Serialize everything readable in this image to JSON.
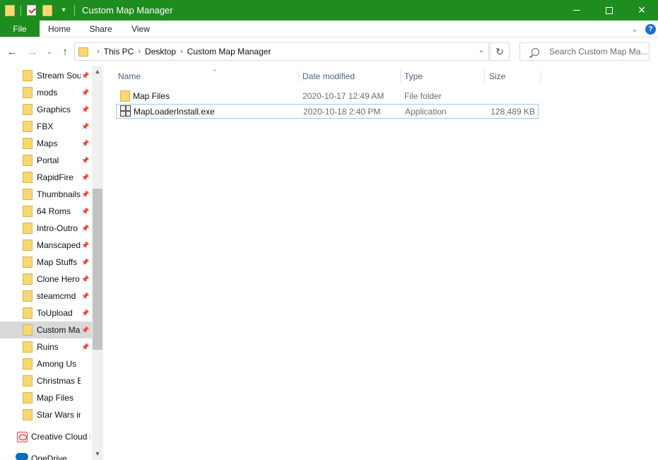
{
  "window": {
    "title": "Custom Map Manager",
    "accent_color": "#1e8c1e"
  },
  "ribbon": {
    "tabs": [
      "File",
      "Home",
      "Share",
      "View"
    ],
    "help": "?"
  },
  "address": {
    "crumbs": [
      "This PC",
      "Desktop",
      "Custom Map Manager"
    ]
  },
  "search": {
    "placeholder": "Search Custom Map Ma..."
  },
  "navpane": {
    "quick_access": [
      {
        "label": "Stream Sou",
        "pinned": true,
        "selected": false
      },
      {
        "label": "mods",
        "pinned": true,
        "selected": false
      },
      {
        "label": "Graphics",
        "pinned": true,
        "selected": false
      },
      {
        "label": "FBX",
        "pinned": true,
        "selected": false
      },
      {
        "label": "Maps",
        "pinned": true,
        "selected": false
      },
      {
        "label": "Portal",
        "pinned": true,
        "selected": false
      },
      {
        "label": "RapidFire",
        "pinned": true,
        "selected": false
      },
      {
        "label": "Thumbnails",
        "pinned": true,
        "selected": false
      },
      {
        "label": "64 Roms",
        "pinned": true,
        "selected": false
      },
      {
        "label": "Intro-Outro",
        "pinned": true,
        "selected": false
      },
      {
        "label": "Manscaped",
        "pinned": true,
        "selected": false
      },
      {
        "label": "Map Stuffs",
        "pinned": true,
        "selected": false
      },
      {
        "label": "Clone Hero",
        "pinned": true,
        "selected": false
      },
      {
        "label": "steamcmd",
        "pinned": true,
        "selected": false
      },
      {
        "label": "ToUpload",
        "pinned": true,
        "selected": false
      },
      {
        "label": "Custom Ma",
        "pinned": true,
        "selected": true
      },
      {
        "label": "Ruins",
        "pinned": true,
        "selected": false
      },
      {
        "label": "Among Us",
        "pinned": false,
        "selected": false
      },
      {
        "label": "Christmas BTS",
        "pinned": false,
        "selected": false
      },
      {
        "label": "Map Files",
        "pinned": false,
        "selected": false
      },
      {
        "label": "Star Wars in Ro",
        "pinned": false,
        "selected": false
      }
    ],
    "creative_cloud": "Creative Cloud F",
    "onedrive": "OneDrive"
  },
  "columns": {
    "name": "Name",
    "date": "Date modified",
    "type": "Type",
    "size": "Size"
  },
  "files": [
    {
      "name": "Map Files",
      "date": "2020-10-17 12:49 AM",
      "type": "File folder",
      "size": "",
      "icon": "folder-icon"
    },
    {
      "name": "MapLoaderInstall.exe",
      "date": "2020-10-18 2:40 PM",
      "type": "Application",
      "size": "128,489 KB",
      "icon": "installer-icon"
    }
  ]
}
